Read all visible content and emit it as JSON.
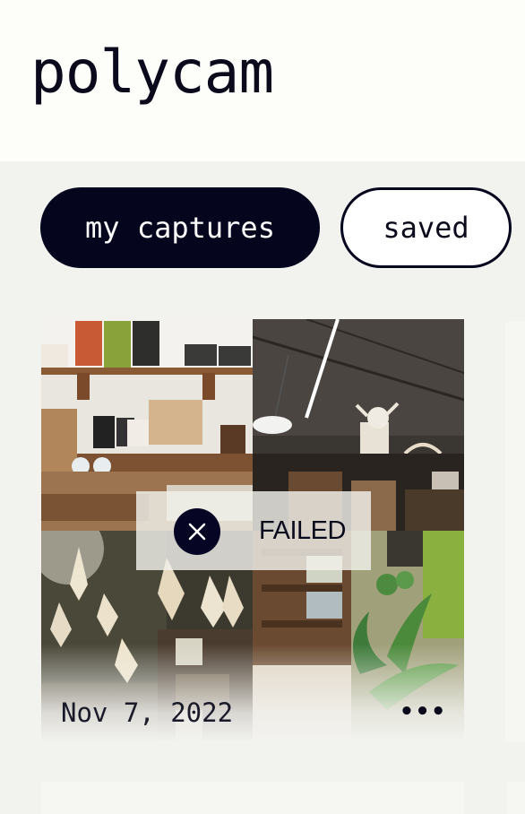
{
  "app": {
    "logo_text": "polycam"
  },
  "tabs": [
    {
      "label": "my captures",
      "active": true
    },
    {
      "label": "saved",
      "active": false
    }
  ],
  "captures": [
    {
      "date": "Nov 7, 2022",
      "status": "FAILED",
      "status_icon": "close-icon",
      "more_icon": "more-horizontal-icon",
      "more_glyph": "•••"
    }
  ],
  "colors": {
    "brand_dark": "#05051e",
    "background": "#f2f2ef",
    "header_bg": "#fdfdfa",
    "white": "#ffffff"
  }
}
